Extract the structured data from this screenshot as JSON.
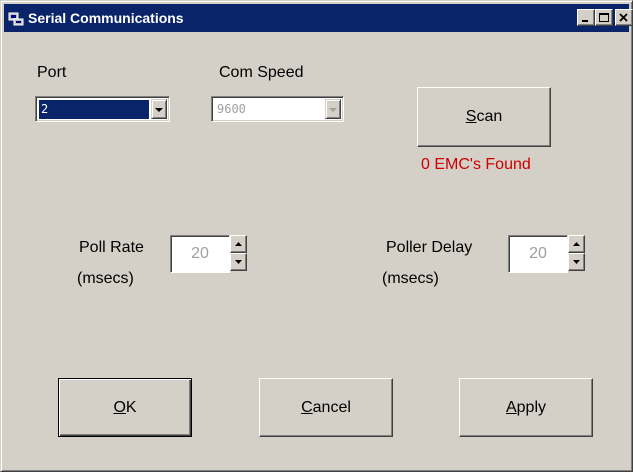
{
  "window": {
    "title": "Serial Communications",
    "title_icon": "serial-port-icon",
    "controls": [
      "minimize-icon",
      "maximize-icon",
      "close-icon"
    ]
  },
  "port": {
    "label": "Port",
    "value": "2"
  },
  "com_speed": {
    "label": "Com Speed",
    "value": "9600",
    "disabled": true
  },
  "scan": {
    "label_mnemonic": "S",
    "label_rest": "can",
    "status": "0 EMC's Found",
    "status_color": "#cc0000"
  },
  "poll_rate": {
    "label_line1": "Poll Rate",
    "label_line2": "(msecs)",
    "value": "20"
  },
  "poller_delay": {
    "label_line1": "Poller Delay",
    "label_line2": "(msecs)",
    "value": "20"
  },
  "buttons": {
    "ok": {
      "mnemonic": "O",
      "rest": "K"
    },
    "cancel": {
      "mnemonic": "C",
      "rest": "ancel"
    },
    "apply": {
      "mnemonic": "A",
      "rest": "pply"
    }
  },
  "colors": {
    "title_bar": "#0a246a",
    "face": "#d4d0c8",
    "selection": "#0a246a"
  }
}
